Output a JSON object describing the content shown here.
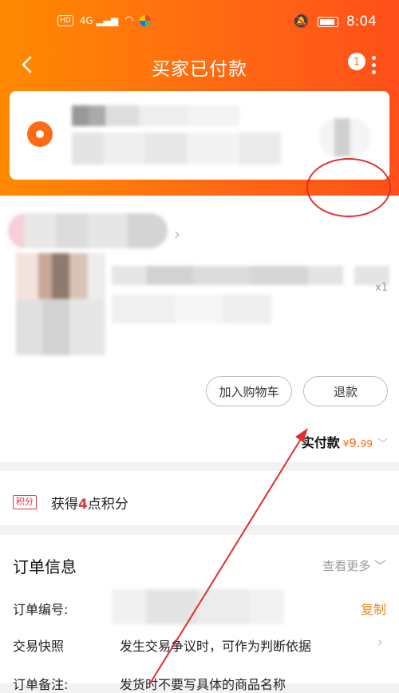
{
  "status_bar": {
    "hd_label": "HD",
    "network_label": "4G",
    "time": "8:04"
  },
  "nav": {
    "title": "买家已付款",
    "back_icon": "chevron-left-icon",
    "more_icon": "more-vertical-icon",
    "notification_count": "1"
  },
  "address_card": {
    "icon": "location-pin-icon",
    "content_redacted": true
  },
  "order": {
    "quantity": "x1",
    "buttons": {
      "add_to_cart": "加入购物车",
      "refund": "退款"
    },
    "paid_label": "实付款",
    "paid_currency": "¥",
    "paid_amount_int": "9.",
    "paid_amount_dec": "99"
  },
  "points": {
    "tag": "积分",
    "text_prefix": "获得",
    "points": "4",
    "text_suffix": "点积分"
  },
  "order_info": {
    "title": "订单信息",
    "see_more": "查看更多",
    "rows": [
      {
        "label": "订单编号:",
        "action": "复制"
      },
      {
        "label": "交易快照",
        "value": "发生交易争议时，可作为判断依据"
      },
      {
        "label": "订单备注:",
        "value": "发货时不要写具体的商品名称"
      }
    ]
  },
  "colors": {
    "brand_orange": "#ff6a13",
    "annotation_red": "#e32d2d",
    "copy_orange": "#f08a24"
  }
}
